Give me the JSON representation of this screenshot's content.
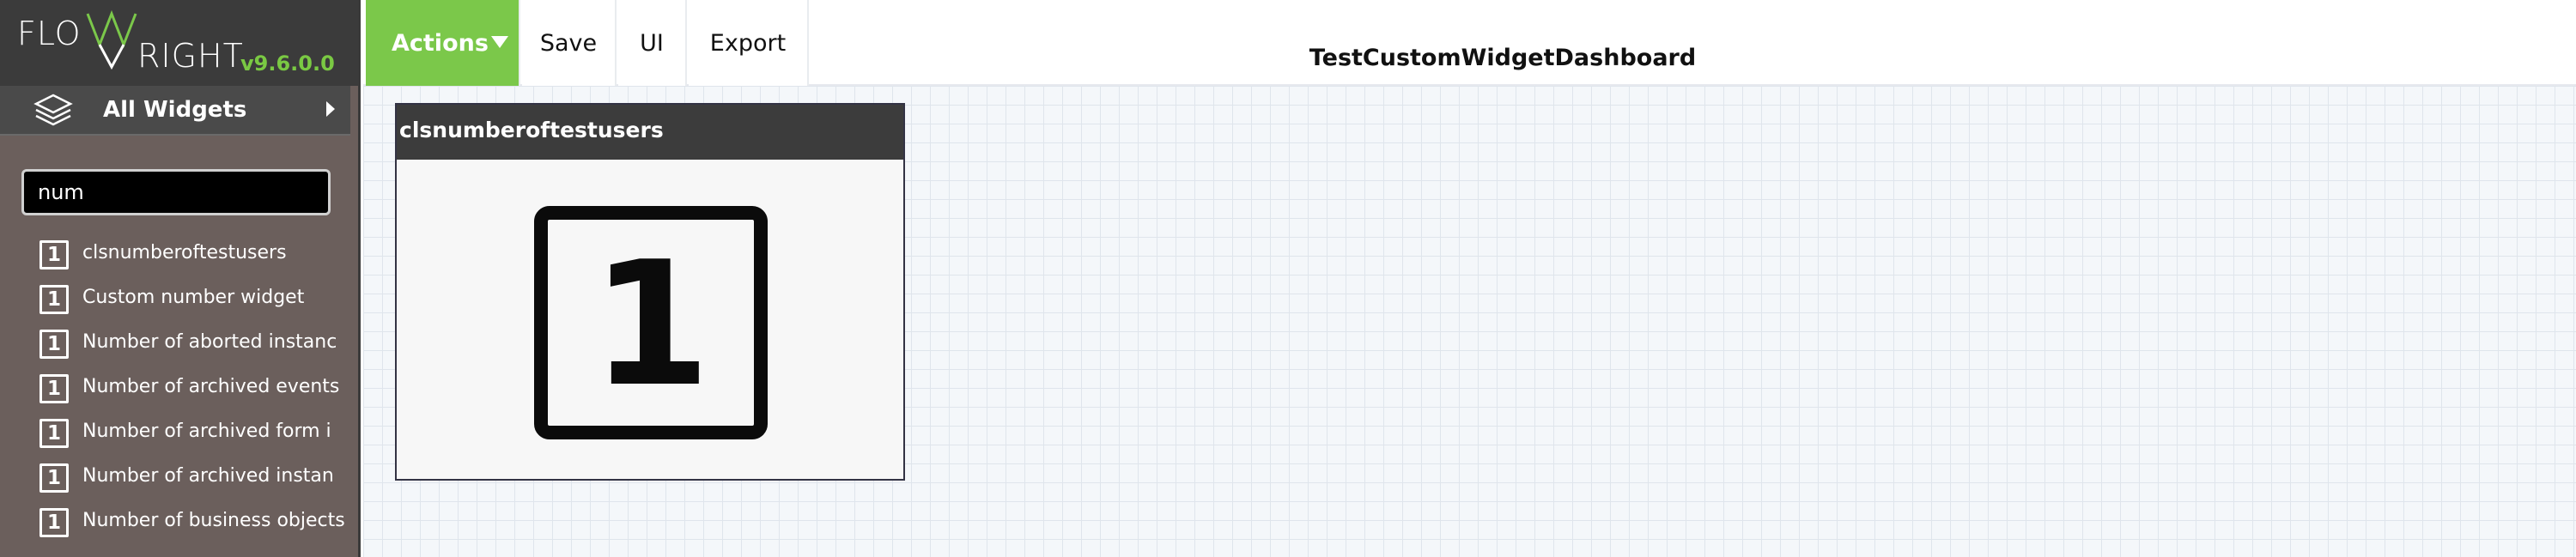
{
  "brand": {
    "logo_text": "FLOWRIGHT",
    "version": "v9.6.0.0"
  },
  "sidebar": {
    "widget_header_label": "All Widgets",
    "search_value": "num",
    "items": [
      {
        "icon": "1",
        "label": "clsnumberoftestusers"
      },
      {
        "icon": "1",
        "label": "Custom number widget"
      },
      {
        "icon": "1",
        "label": "Number of aborted instanc"
      },
      {
        "icon": "1",
        "label": "Number of archived events"
      },
      {
        "icon": "1",
        "label": "Number of archived form i"
      },
      {
        "icon": "1",
        "label": "Number of archived instan"
      },
      {
        "icon": "1",
        "label": "Number of business objects"
      }
    ]
  },
  "toolbar": {
    "actions_label": "Actions",
    "save_label": "Save",
    "ui_label": "UI",
    "export_label": "Export"
  },
  "dashboard": {
    "title": "TestCustomWidgetDashboard"
  },
  "widget": {
    "title": "clsnumberoftestusers",
    "value": "1"
  },
  "colors": {
    "accent_green": "#7bc84a",
    "sidebar_bg": "#6b5f5c",
    "header_dark": "#3c3c3c"
  }
}
